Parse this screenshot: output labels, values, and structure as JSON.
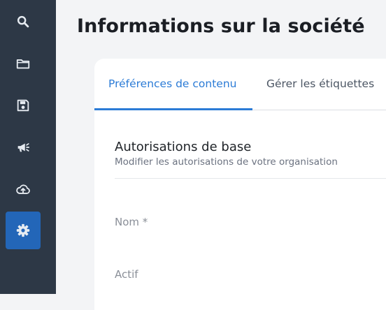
{
  "sidebar": {
    "items": [
      {
        "icon": "search-icon",
        "active": false
      },
      {
        "icon": "folder-icon",
        "active": false
      },
      {
        "icon": "save-icon",
        "active": false
      },
      {
        "icon": "megaphone-icon",
        "active": false
      },
      {
        "icon": "cloud-upload-icon",
        "active": false
      },
      {
        "icon": "gear-icon",
        "active": true
      }
    ]
  },
  "page": {
    "title": "Informations sur la société"
  },
  "tabs": [
    {
      "label": "Préférences de contenu",
      "active": true
    },
    {
      "label": "Gérer les étiquettes",
      "active": false
    }
  ],
  "section": {
    "title": "Autorisations de base",
    "subtitle": "Modifier les autorisations de votre organisation"
  },
  "fields": {
    "name_label": "Nom *",
    "active_label": "Actif"
  },
  "colors": {
    "sidebar_bg": "#2d3846",
    "sidebar_active": "#2366b8",
    "accent": "#2b7bd6",
    "page_bg": "#f3f4f6"
  }
}
